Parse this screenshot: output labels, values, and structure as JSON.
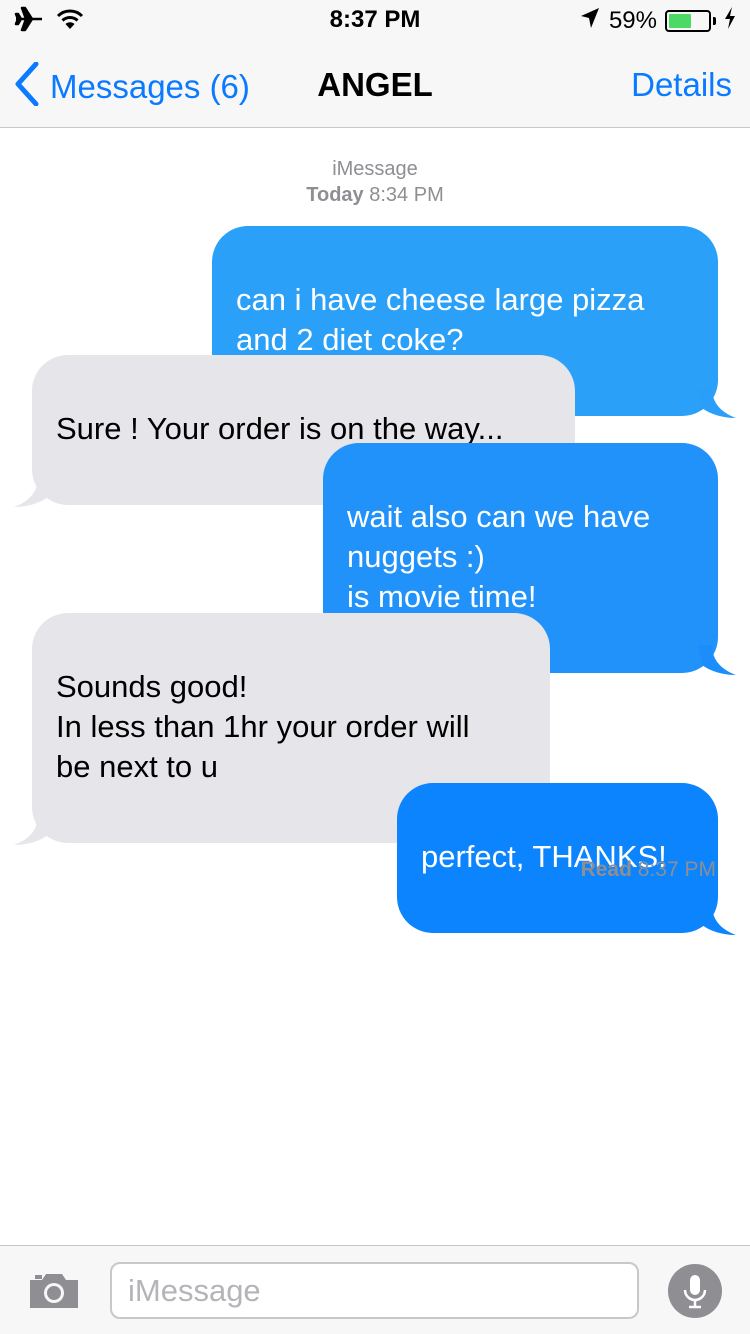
{
  "status_bar": {
    "time": "8:37 PM",
    "battery_percent_label": "59%",
    "battery_level": 0.59,
    "icons": [
      "airplane-icon",
      "wifi-icon",
      "location-icon",
      "battery-icon",
      "charging-bolt-icon"
    ]
  },
  "nav": {
    "back_label": "Messages (6)",
    "title": "ANGEL",
    "details_label": "Details"
  },
  "conversation": {
    "service": "iMessage",
    "day": "Today",
    "time": "8:34 PM",
    "messages": [
      {
        "direction": "outgoing",
        "text": "can i have cheese large pizza\nand 2 diet coke?"
      },
      {
        "direction": "incoming",
        "text": "Sure ! Your order is on the way..."
      },
      {
        "direction": "outgoing",
        "text": "wait also can we have\nnuggets :)\nis movie time!"
      },
      {
        "direction": "incoming",
        "text": "Sounds good!\nIn less than 1hr your order will\nbe next to u"
      },
      {
        "direction": "outgoing",
        "text": "perfect, THANKS!"
      }
    ],
    "read_label": "Read",
    "read_time": "8:37 PM"
  },
  "composer": {
    "placeholder": "iMessage",
    "value": "",
    "icons": [
      "camera-icon",
      "microphone-icon"
    ]
  },
  "colors": {
    "accent": "#0a7aff",
    "outgoing_bubble_top": "#2aa0f9",
    "outgoing_bubble_bottom": "#0b84fe",
    "incoming_bubble": "#e5e5ea",
    "battery_fill": "#4cd964",
    "meta_text": "#8e8e93"
  }
}
